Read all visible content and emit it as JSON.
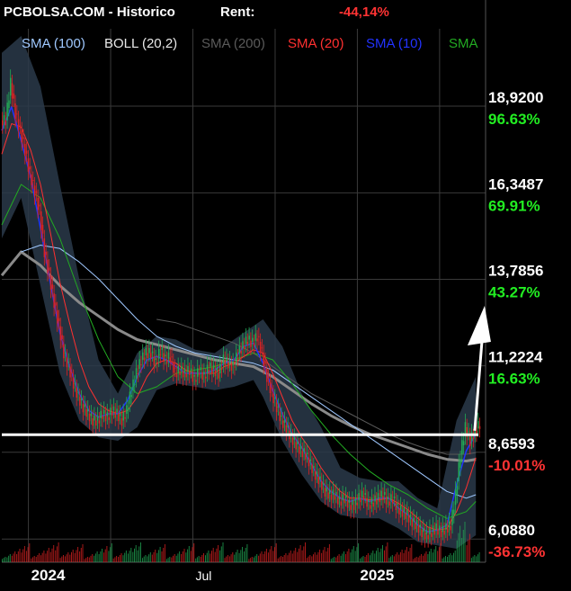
{
  "header": {
    "site": "PCBOLSA.COM - Historico",
    "rent_label": "Rent:",
    "rent_value": "-44,14%"
  },
  "legend": [
    {
      "label": "SMA (100)",
      "color": "#9fc8ff"
    },
    {
      "label": "BOLL (20,2)",
      "color": "#e8e8e8"
    },
    {
      "label": "SMA (200)",
      "color": "#5a5a5a"
    },
    {
      "label": "SMA (20)",
      "color": "#ff3030"
    },
    {
      "label": "SMA (10)",
      "color": "#2233ff"
    },
    {
      "label": "SMA",
      "color": "#22aa22"
    }
  ],
  "colors": {
    "background": "#000000",
    "grid": "#3a3a3a",
    "candle_up": "#22aa55",
    "candle_down": "#dd2222",
    "boll_band": "#2a3a4a",
    "positive": "#22ee22",
    "negative": "#ff3333",
    "support_line": "#ffffff",
    "arrow": "#ffffff"
  },
  "chart_data": {
    "type": "candlestick",
    "y_axis": {
      "min": 5.4,
      "max": 21.0,
      "labels": [
        {
          "value": 18.92,
          "text": "18,9200",
          "pct": "96.63%",
          "pct_sign": "positive"
        },
        {
          "value": 16.3487,
          "text": "16,3487",
          "pct": "69.91%",
          "pct_sign": "positive"
        },
        {
          "value": 13.7856,
          "text": "13,7856",
          "pct": "43.27%",
          "pct_sign": "positive"
        },
        {
          "value": 11.2224,
          "text": "11,2224",
          "pct": "16.63%",
          "pct_sign": "positive"
        },
        {
          "value": 8.6593,
          "text": "8,6593",
          "pct": "-10.01%",
          "pct_sign": "negative"
        },
        {
          "value": 6.088,
          "text": "6,0880",
          "pct": "-36.73%",
          "pct_sign": "negative"
        }
      ]
    },
    "x_axis": {
      "range": [
        0,
        100
      ],
      "labels": [
        {
          "pos": 5.5,
          "text": "2024",
          "style": "year"
        },
        {
          "pos": 39.5,
          "text": "Jul",
          "style": "month"
        },
        {
          "pos": 73.5,
          "text": "2025",
          "style": "year"
        }
      ],
      "grid": [
        5.5,
        22.5,
        39.5,
        56.5,
        73.5,
        90.5
      ]
    },
    "close_series": [
      [
        0,
        18.5
      ],
      [
        1,
        19.6
      ],
      [
        2,
        18.7
      ],
      [
        3,
        18.2
      ],
      [
        4,
        17.6
      ],
      [
        5,
        16.9
      ],
      [
        6,
        16.4
      ],
      [
        7,
        15.8
      ],
      [
        8,
        14.6
      ],
      [
        9,
        13.9
      ],
      [
        10,
        13.1
      ],
      [
        11,
        12.4
      ],
      [
        12,
        11.6
      ],
      [
        13,
        11.2
      ],
      [
        14,
        10.7
      ],
      [
        15,
        10.3
      ],
      [
        16,
        10.0
      ],
      [
        17,
        9.8
      ],
      [
        18,
        9.6
      ],
      [
        19,
        9.6
      ],
      [
        20,
        9.8
      ],
      [
        21,
        9.7
      ],
      [
        22,
        9.9
      ],
      [
        23,
        9.8
      ],
      [
        24,
        9.6
      ],
      [
        25,
        9.9
      ],
      [
        26,
        10.5
      ],
      [
        27,
        11.0
      ],
      [
        28,
        11.4
      ],
      [
        29,
        11.6
      ],
      [
        30,
        11.6
      ],
      [
        31,
        11.3
      ],
      [
        32,
        11.7
      ],
      [
        33,
        11.4
      ],
      [
        34,
        11.5
      ],
      [
        35,
        11.0
      ],
      [
        36,
        11.1
      ],
      [
        37,
        11.0
      ],
      [
        38,
        11.1
      ],
      [
        39,
        10.8
      ],
      [
        40,
        11.1
      ],
      [
        41,
        10.9
      ],
      [
        42,
        11.2
      ],
      [
        43,
        11.1
      ],
      [
        44,
        11.0
      ],
      [
        45,
        11.4
      ],
      [
        46,
        11.3
      ],
      [
        47,
        11.2
      ],
      [
        48,
        11.6
      ],
      [
        49,
        11.8
      ],
      [
        50,
        12.0
      ],
      [
        51,
        11.9
      ],
      [
        52,
        12.1
      ],
      [
        53,
        11.6
      ],
      [
        54,
        10.9
      ],
      [
        55,
        10.4
      ],
      [
        56,
        10.0
      ],
      [
        57,
        9.6
      ],
      [
        58,
        9.4
      ],
      [
        59,
        9.1
      ],
      [
        60,
        8.9
      ],
      [
        61,
        8.7
      ],
      [
        62,
        8.6
      ],
      [
        63,
        8.3
      ],
      [
        64,
        8.0
      ],
      [
        65,
        7.8
      ],
      [
        66,
        7.5
      ],
      [
        67,
        7.4
      ],
      [
        68,
        7.4
      ],
      [
        69,
        7.2
      ],
      [
        70,
        7.3
      ],
      [
        71,
        7.1
      ],
      [
        72,
        7.1
      ],
      [
        73,
        7.3
      ],
      [
        74,
        7.4
      ],
      [
        75,
        7.1
      ],
      [
        76,
        7.2
      ],
      [
        77,
        7.3
      ],
      [
        78,
        7.4
      ],
      [
        79,
        7.2
      ],
      [
        80,
        7.3
      ],
      [
        81,
        7.0
      ],
      [
        82,
        6.9
      ],
      [
        83,
        6.8
      ],
      [
        84,
        6.6
      ],
      [
        85,
        6.5
      ],
      [
        86,
        6.3
      ],
      [
        87,
        6.2
      ],
      [
        88,
        6.3
      ],
      [
        89,
        6.4
      ],
      [
        90,
        6.3
      ],
      [
        91,
        6.4
      ],
      [
        92,
        6.5
      ],
      [
        93,
        7.4
      ],
      [
        94,
        8.6
      ],
      [
        95,
        9.4
      ],
      [
        96,
        9.0
      ],
      [
        97,
        9.3
      ],
      [
        98,
        9.5
      ]
    ],
    "sma10": [
      [
        0,
        18.2
      ],
      [
        2,
        18.9
      ],
      [
        4,
        17.9
      ],
      [
        6,
        16.8
      ],
      [
        8,
        15.3
      ],
      [
        10,
        13.7
      ],
      [
        12,
        12.2
      ],
      [
        14,
        11.2
      ],
      [
        16,
        10.4
      ],
      [
        18,
        9.9
      ],
      [
        20,
        9.7
      ],
      [
        22,
        9.8
      ],
      [
        24,
        9.8
      ],
      [
        26,
        10.2
      ],
      [
        28,
        10.9
      ],
      [
        30,
        11.4
      ],
      [
        32,
        11.5
      ],
      [
        34,
        11.4
      ],
      [
        36,
        11.2
      ],
      [
        38,
        11.0
      ],
      [
        40,
        11.0
      ],
      [
        42,
        11.0
      ],
      [
        44,
        11.1
      ],
      [
        46,
        11.3
      ],
      [
        48,
        11.4
      ],
      [
        50,
        11.8
      ],
      [
        52,
        11.9
      ],
      [
        54,
        11.3
      ],
      [
        56,
        10.5
      ],
      [
        58,
        9.8
      ],
      [
        60,
        9.2
      ],
      [
        62,
        8.8
      ],
      [
        64,
        8.3
      ],
      [
        66,
        7.8
      ],
      [
        68,
        7.5
      ],
      [
        70,
        7.3
      ],
      [
        72,
        7.2
      ],
      [
        74,
        7.3
      ],
      [
        76,
        7.2
      ],
      [
        78,
        7.3
      ],
      [
        80,
        7.3
      ],
      [
        82,
        7.0
      ],
      [
        84,
        6.8
      ],
      [
        86,
        6.5
      ],
      [
        88,
        6.3
      ],
      [
        90,
        6.35
      ],
      [
        92,
        6.5
      ],
      [
        94,
        7.7
      ],
      [
        96,
        8.7
      ],
      [
        98,
        9.2
      ]
    ],
    "sma20": [
      [
        0,
        17.5
      ],
      [
        2,
        18.4
      ],
      [
        4,
        18.3
      ],
      [
        6,
        17.6
      ],
      [
        8,
        16.6
      ],
      [
        10,
        15.2
      ],
      [
        12,
        13.7
      ],
      [
        14,
        12.5
      ],
      [
        16,
        11.4
      ],
      [
        18,
        10.6
      ],
      [
        20,
        10.1
      ],
      [
        22,
        9.9
      ],
      [
        24,
        9.8
      ],
      [
        26,
        9.9
      ],
      [
        28,
        10.3
      ],
      [
        30,
        10.9
      ],
      [
        32,
        11.3
      ],
      [
        34,
        11.4
      ],
      [
        36,
        11.3
      ],
      [
        38,
        11.1
      ],
      [
        40,
        11.0
      ],
      [
        42,
        11.0
      ],
      [
        44,
        11.0
      ],
      [
        46,
        11.2
      ],
      [
        48,
        11.3
      ],
      [
        50,
        11.5
      ],
      [
        52,
        11.7
      ],
      [
        54,
        11.6
      ],
      [
        56,
        11.0
      ],
      [
        58,
        10.3
      ],
      [
        60,
        9.6
      ],
      [
        62,
        9.1
      ],
      [
        64,
        8.7
      ],
      [
        66,
        8.2
      ],
      [
        68,
        7.8
      ],
      [
        70,
        7.5
      ],
      [
        72,
        7.3
      ],
      [
        74,
        7.3
      ],
      [
        76,
        7.25
      ],
      [
        78,
        7.25
      ],
      [
        80,
        7.3
      ],
      [
        82,
        7.15
      ],
      [
        84,
        6.95
      ],
      [
        86,
        6.7
      ],
      [
        88,
        6.45
      ],
      [
        90,
        6.35
      ],
      [
        92,
        6.4
      ],
      [
        94,
        6.9
      ],
      [
        96,
        7.6
      ],
      [
        98,
        8.5
      ]
    ],
    "sma_green": [
      [
        0,
        15.4
      ],
      [
        4,
        16.6
      ],
      [
        8,
        16.2
      ],
      [
        12,
        15.0
      ],
      [
        16,
        13.4
      ],
      [
        20,
        12.0
      ],
      [
        24,
        10.9
      ],
      [
        28,
        10.4
      ],
      [
        32,
        10.6
      ],
      [
        36,
        11.0
      ],
      [
        40,
        11.1
      ],
      [
        44,
        11.2
      ],
      [
        48,
        11.4
      ],
      [
        52,
        11.6
      ],
      [
        56,
        11.4
      ],
      [
        60,
        10.7
      ],
      [
        64,
        9.9
      ],
      [
        68,
        9.2
      ],
      [
        72,
        8.6
      ],
      [
        76,
        8.1
      ],
      [
        80,
        7.7
      ],
      [
        84,
        7.4
      ],
      [
        88,
        7.0
      ],
      [
        92,
        6.7
      ],
      [
        96,
        6.9
      ],
      [
        98,
        7.2
      ]
    ],
    "sma100": [
      [
        4,
        14.6
      ],
      [
        8,
        14.8
      ],
      [
        12,
        14.7
      ],
      [
        16,
        14.3
      ],
      [
        20,
        13.8
      ],
      [
        24,
        13.2
      ],
      [
        28,
        12.6
      ],
      [
        32,
        12.1
      ],
      [
        36,
        11.8
      ],
      [
        40,
        11.6
      ],
      [
        44,
        11.5
      ],
      [
        48,
        11.4
      ],
      [
        52,
        11.3
      ],
      [
        56,
        11.1
      ],
      [
        60,
        10.7
      ],
      [
        64,
        10.3
      ],
      [
        68,
        9.9
      ],
      [
        72,
        9.5
      ],
      [
        76,
        9.1
      ],
      [
        80,
        8.7
      ],
      [
        84,
        8.3
      ],
      [
        88,
        7.9
      ],
      [
        92,
        7.5
      ],
      [
        96,
        7.3
      ],
      [
        98,
        7.4
      ]
    ],
    "sma200": [
      [
        0,
        13.9
      ],
      [
        4,
        14.6
      ],
      [
        8,
        14.2
      ],
      [
        12,
        13.6
      ],
      [
        16,
        13.1
      ],
      [
        20,
        12.7
      ],
      [
        24,
        12.3
      ],
      [
        28,
        12.0
      ],
      [
        32,
        11.85
      ],
      [
        36,
        11.7
      ],
      [
        40,
        11.55
      ],
      [
        44,
        11.4
      ],
      [
        48,
        11.3
      ],
      [
        52,
        11.2
      ],
      [
        56,
        10.9
      ],
      [
        60,
        10.5
      ],
      [
        64,
        10.1
      ],
      [
        68,
        9.75
      ],
      [
        72,
        9.45
      ],
      [
        76,
        9.2
      ],
      [
        80,
        9.0
      ],
      [
        84,
        8.8
      ],
      [
        88,
        8.6
      ],
      [
        92,
        8.45
      ],
      [
        96,
        8.4
      ],
      [
        98,
        8.45
      ]
    ],
    "sma_dim": [
      [
        32,
        12.6
      ],
      [
        36,
        12.5
      ],
      [
        40,
        12.3
      ],
      [
        44,
        12.1
      ],
      [
        48,
        11.9
      ],
      [
        52,
        11.6
      ],
      [
        56,
        11.2
      ],
      [
        60,
        10.8
      ],
      [
        64,
        10.4
      ],
      [
        68,
        10.1
      ],
      [
        72,
        9.8
      ],
      [
        76,
        9.5
      ],
      [
        80,
        9.2
      ],
      [
        84,
        8.95
      ],
      [
        88,
        8.75
      ],
      [
        92,
        8.6
      ],
      [
        96,
        8.6
      ],
      [
        98,
        8.65
      ]
    ],
    "boll_upper": [
      [
        0,
        20.5
      ],
      [
        4,
        21.0
      ],
      [
        8,
        19.5
      ],
      [
        12,
        16.6
      ],
      [
        16,
        13.8
      ],
      [
        20,
        11.4
      ],
      [
        24,
        10.4
      ],
      [
        28,
        11.6
      ],
      [
        32,
        12.1
      ],
      [
        36,
        12.0
      ],
      [
        40,
        11.7
      ],
      [
        44,
        11.6
      ],
      [
        48,
        12.0
      ],
      [
        52,
        12.4
      ],
      [
        54,
        12.6
      ],
      [
        58,
        11.8
      ],
      [
        62,
        10.4
      ],
      [
        66,
        9.4
      ],
      [
        70,
        8.2
      ],
      [
        74,
        7.9
      ],
      [
        78,
        7.8
      ],
      [
        82,
        7.8
      ],
      [
        86,
        7.3
      ],
      [
        90,
        7.0
      ],
      [
        94,
        9.6
      ],
      [
        98,
        10.9
      ]
    ],
    "boll_lower": [
      [
        0,
        15.0
      ],
      [
        4,
        16.2
      ],
      [
        8,
        13.6
      ],
      [
        12,
        11.0
      ],
      [
        16,
        9.6
      ],
      [
        20,
        9.1
      ],
      [
        24,
        9.0
      ],
      [
        28,
        9.4
      ],
      [
        32,
        10.5
      ],
      [
        36,
        10.7
      ],
      [
        40,
        10.6
      ],
      [
        44,
        10.5
      ],
      [
        48,
        10.6
      ],
      [
        52,
        10.8
      ],
      [
        54,
        10.3
      ],
      [
        58,
        9.0
      ],
      [
        62,
        8.0
      ],
      [
        66,
        7.2
      ],
      [
        70,
        6.8
      ],
      [
        74,
        6.7
      ],
      [
        78,
        6.7
      ],
      [
        82,
        6.4
      ],
      [
        86,
        6.0
      ],
      [
        90,
        5.9
      ],
      [
        94,
        5.8
      ],
      [
        98,
        6.2
      ]
    ],
    "support_level": 9.18,
    "arrow": {
      "x": 98.5,
      "from": 9.3,
      "to": 13.0
    },
    "volume_peaks": [
      [
        94,
        0.9
      ],
      [
        95,
        1.0
      ],
      [
        96,
        0.7
      ]
    ]
  }
}
